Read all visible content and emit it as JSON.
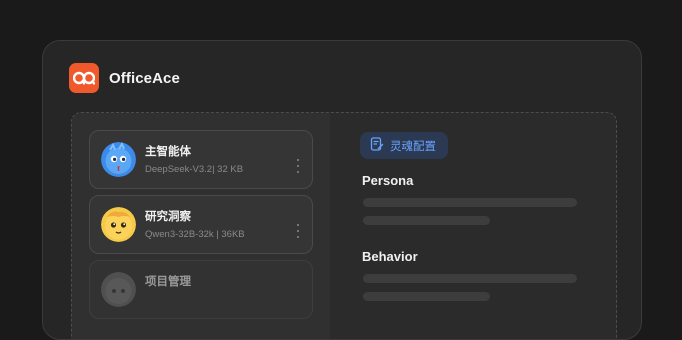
{
  "app": {
    "title": "OfficeAce"
  },
  "agents": [
    {
      "name": "主智能体",
      "meta": "DeepSeek-V3.2| 32 KB",
      "avatar": "blue-character-avatar"
    },
    {
      "name": "研究洞察",
      "meta": "Qwen3-32B-32k | 36KB",
      "avatar": "yellow-character-avatar"
    },
    {
      "name": "项目管理",
      "meta": "",
      "avatar": "gray-character-avatar"
    }
  ],
  "config": {
    "tab_label": "灵魂配置",
    "tab_icon": "document-edit-icon",
    "sections": [
      {
        "title": "Persona"
      },
      {
        "title": "Behavior"
      }
    ]
  },
  "colors": {
    "accent": "#6aa2ff",
    "brand": "#f0592c",
    "background": "#1a1a1a",
    "panel": "#262626"
  }
}
